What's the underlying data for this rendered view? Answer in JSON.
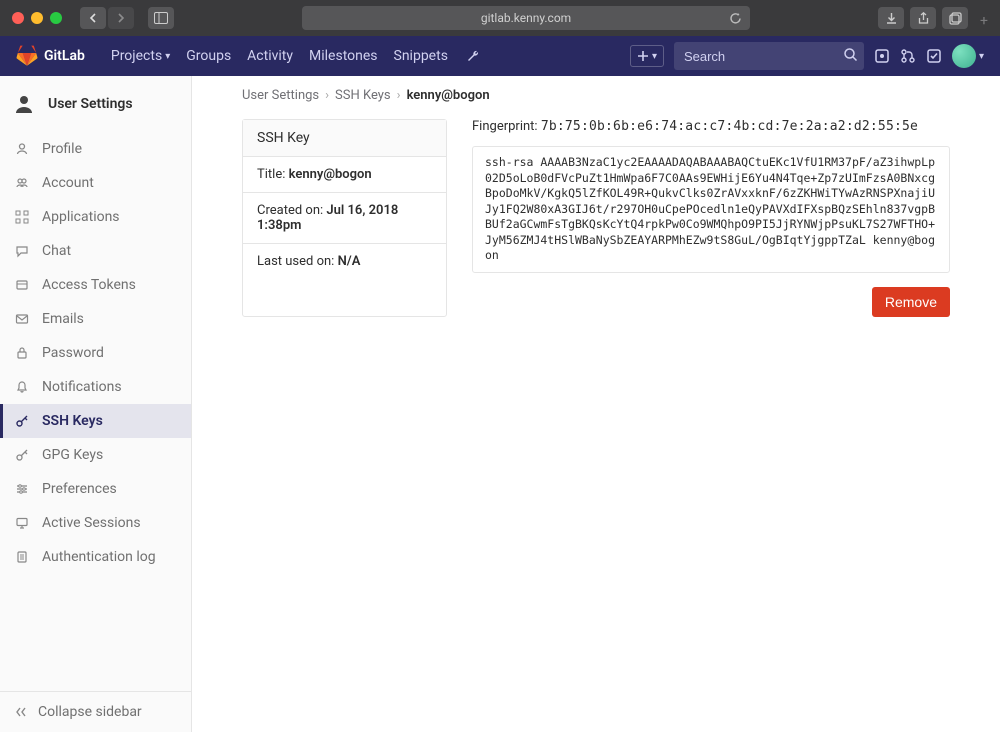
{
  "browser": {
    "address": "gitlab.kenny.com"
  },
  "header": {
    "brand": "GitLab",
    "nav": {
      "projects": "Projects",
      "groups": "Groups",
      "activity": "Activity",
      "milestones": "Milestones",
      "snippets": "Snippets"
    },
    "search_placeholder": "Search"
  },
  "sidebar": {
    "heading": "User Settings",
    "items": [
      {
        "label": "Profile"
      },
      {
        "label": "Account"
      },
      {
        "label": "Applications"
      },
      {
        "label": "Chat"
      },
      {
        "label": "Access Tokens"
      },
      {
        "label": "Emails"
      },
      {
        "label": "Password"
      },
      {
        "label": "Notifications"
      },
      {
        "label": "SSH Keys"
      },
      {
        "label": "GPG Keys"
      },
      {
        "label": "Preferences"
      },
      {
        "label": "Active Sessions"
      },
      {
        "label": "Authentication log"
      }
    ],
    "collapse": "Collapse sidebar"
  },
  "breadcrumb": {
    "root": "User Settings",
    "section": "SSH Keys",
    "current": "kenny@bogon"
  },
  "card": {
    "heading": "SSH Key",
    "title_label": "Title:",
    "title_value": "kenny@bogon",
    "created_label": "Created on:",
    "created_value": "Jul 16, 2018 1:38pm",
    "last_used_label": "Last used on:",
    "last_used_value": "N/A"
  },
  "key": {
    "fingerprint_label": "Fingerprint:",
    "fingerprint_value": "7b:75:0b:6b:e6:74:ac:c7:4b:cd:7e:2a:a2:d2:55:5e",
    "public_key": "ssh-rsa AAAAB3NzaC1yc2EAAAADAQABAAABAQCtuEKc1VfU1RM37pF/aZ3ihwpLp02D5oLoB0dFVcPuZt1HmWpa6F7C0AAs9EWHijE6Yu4N4Tqe+Zp7zUImFzsA0BNxcgBpoDoMkV/KgkQ5lZfKOL49R+QukvClks0ZrAVxxknF/6zZKHWiTYwAzRNSPXnajiUJy1FQ2W80xA3GIJ6t/r297OH0uCpePOcedln1eQyPAVXdIFXspBQzSEhln837vgpBBUf2aGCwmFsTgBKQsKcYtQ4rpkPw0Co9WMQhpO9PI5JjRYNWjpPsuKL7S27WFTHO+JyM56ZMJ4tHSlWBaNySbZEAYARPMhEZw9tS8GuL/OgBIqtYjgppTZaL kenny@bogon"
  },
  "actions": {
    "remove": "Remove"
  }
}
